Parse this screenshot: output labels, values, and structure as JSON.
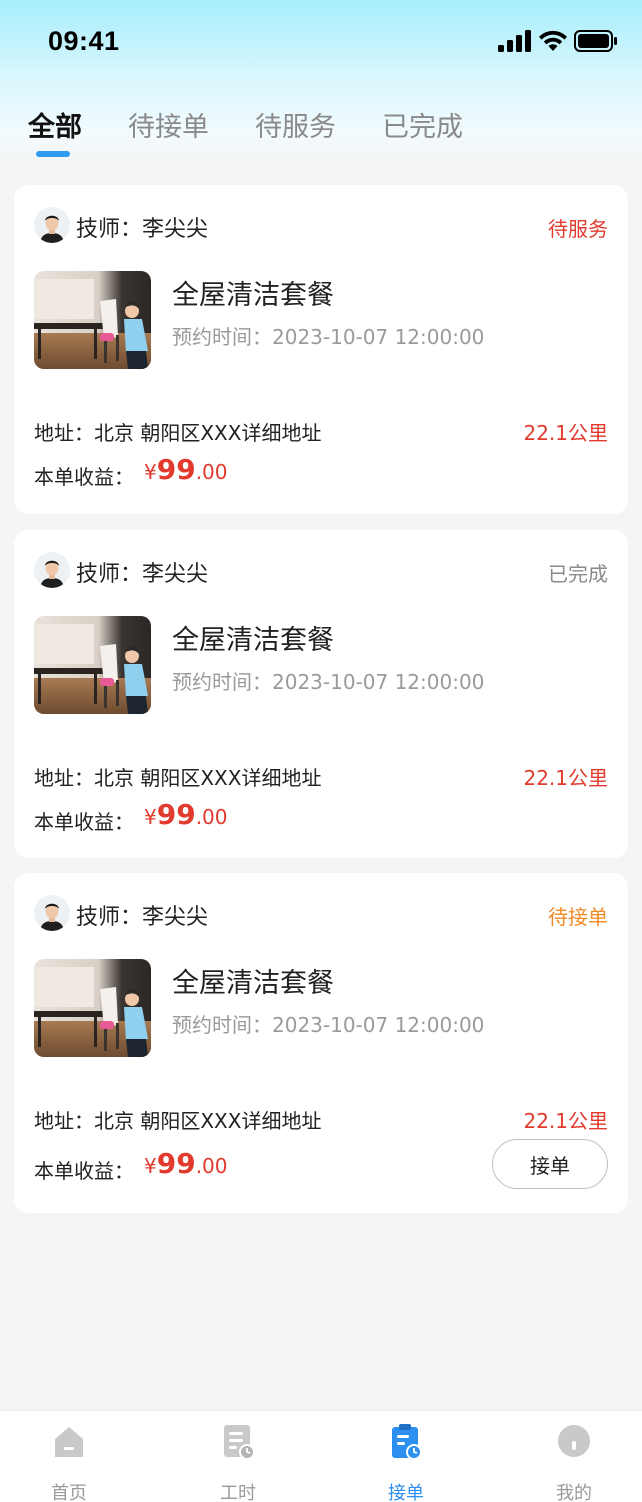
{
  "status_bar": {
    "time": "09:41"
  },
  "tabs": [
    {
      "label": "全部",
      "active": true
    },
    {
      "label": "待接单",
      "active": false
    },
    {
      "label": "待服务",
      "active": false
    },
    {
      "label": "已完成",
      "active": false
    }
  ],
  "orders": [
    {
      "tech_label": "技师：李尖尖",
      "status": "待服务",
      "status_color": "#e23b2e",
      "service_name": "全屋清洁套餐",
      "appointment": "预约时间：2023-10-07 12:00:00",
      "address": "地址：北京 朝阳区XXX详细地址",
      "distance": "22.1公里",
      "income_label": "本单收益：",
      "income_currency": "¥",
      "income_int": "99",
      "income_dec": ".00"
    },
    {
      "tech_label": "技师：李尖尖",
      "status": "已完成",
      "status_color": "#8a8a8a",
      "service_name": "全屋清洁套餐",
      "appointment": "预约时间：2023-10-07 12:00:00",
      "address": "地址：北京 朝阳区XXX详细地址",
      "distance": "22.1公里",
      "income_label": "本单收益：",
      "income_currency": "¥",
      "income_int": "99",
      "income_dec": ".00"
    },
    {
      "tech_label": "技师：李尖尖",
      "status": "待接单",
      "status_color": "#f08a24",
      "service_name": "全屋清洁套餐",
      "appointment": "预约时间：2023-10-07 12:00:00",
      "address": "地址：北京 朝阳区XXX详细地址",
      "distance": "22.1公里",
      "income_label": "本单收益：",
      "income_currency": "¥",
      "income_int": "99",
      "income_dec": ".00",
      "action_label": "接单"
    }
  ],
  "bottom_nav": [
    {
      "label": "首页",
      "icon": "home-icon",
      "active": false
    },
    {
      "label": "工时",
      "icon": "timesheet-icon",
      "active": false
    },
    {
      "label": "接单",
      "icon": "clipboard-clock-icon",
      "active": true
    },
    {
      "label": "我的",
      "icon": "profile-icon",
      "active": false
    }
  ],
  "colors": {
    "accent": "#2d9cf0",
    "price": "#e23b2e",
    "pending_accept": "#f08a24",
    "completed": "#8a8a8a"
  }
}
